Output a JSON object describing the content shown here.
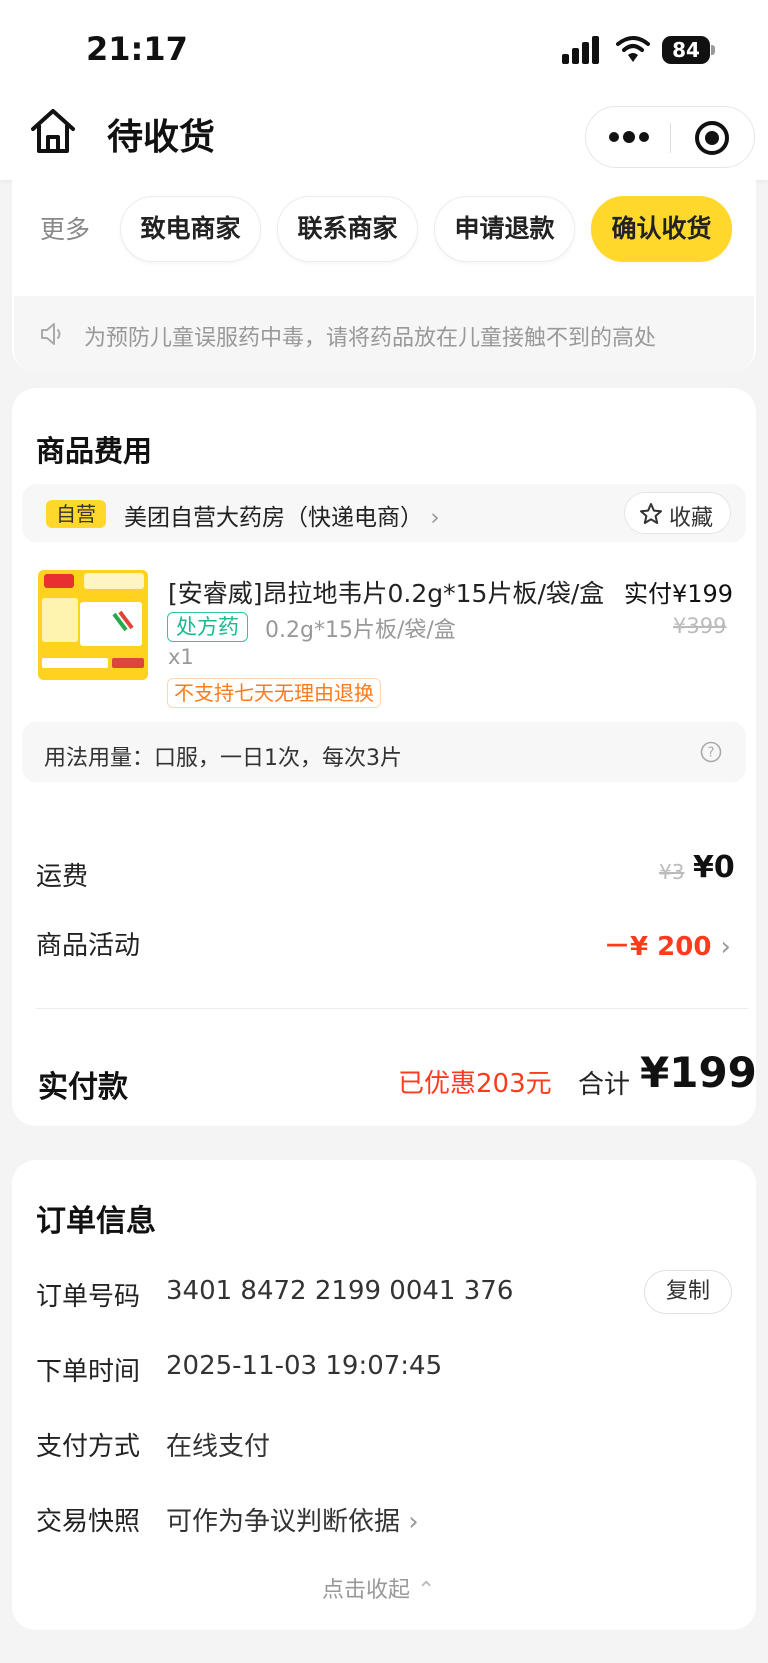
{
  "status_bar": {
    "time": "21:17",
    "battery": "84"
  },
  "nav": {
    "title": "待收货"
  },
  "actions": {
    "more": "更多",
    "call_merchant": "致电商家",
    "contact_merchant": "联系商家",
    "refund": "申请退款",
    "confirm_receipt": "确认收货"
  },
  "notice": "为预防儿童误服药中毒，请将药品放在儿童接触不到的高处",
  "fees": {
    "title": "商品费用",
    "store": {
      "badge": "自营",
      "name": "美团自营大药房（快递电商）",
      "favorite": "收藏"
    },
    "product": {
      "name": "[安睿威]昂拉地韦片0.2g*15片板/袋/盒",
      "paid_price": "实付¥199",
      "rx_tag": "处方药",
      "spec": "0.2g*15片板/袋/盒",
      "original_price": "¥399",
      "qty": "x1",
      "return_policy": "不支持七天无理由退换"
    },
    "dosage": "用法用量：口服，一日1次，每次3片",
    "shipping": {
      "label": "运费",
      "original": "¥3",
      "current": "¥0"
    },
    "promo": {
      "label": "商品活动",
      "value": "－¥ 200"
    },
    "payment": {
      "label": "实付款",
      "saved": "已优惠203元",
      "total_label": "合计",
      "total": "¥199"
    }
  },
  "order_info": {
    "title": "订单信息",
    "rows": [
      {
        "label": "订单号码",
        "value": "3401 8472 2199 0041 376"
      },
      {
        "label": "下单时间",
        "value": "2025-11-03 19:07:45"
      },
      {
        "label": "支付方式",
        "value": "在线支付"
      },
      {
        "label": "交易快照",
        "value": "可作为争议判断依据"
      }
    ],
    "copy": "复制",
    "collapse": "点击收起"
  },
  "colors": {
    "accent": "#ffd82b",
    "price_red": "#ff3b1f",
    "rx_green": "#1ab98f",
    "warn_orange": "#ff7a1a"
  }
}
